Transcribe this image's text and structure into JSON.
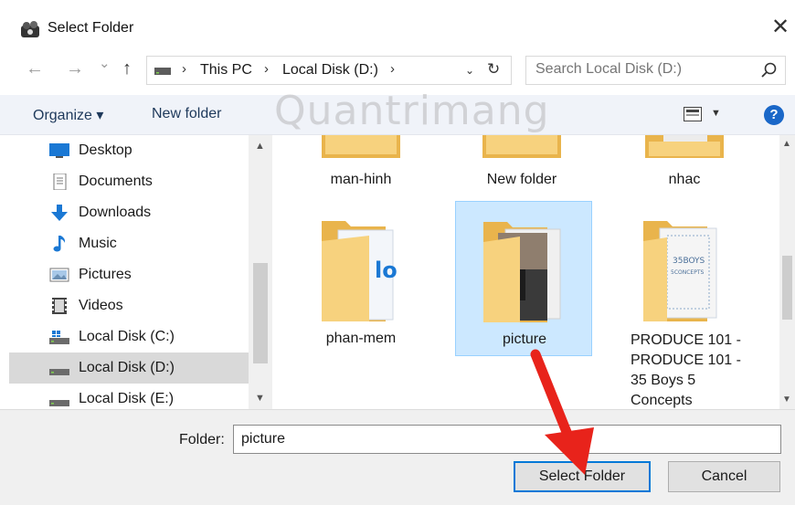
{
  "window": {
    "title": "Select Folder",
    "close_glyph": "✕"
  },
  "nav": {
    "back": "←",
    "forward": "→",
    "recent": "⌄",
    "up": "↑",
    "breadcrumb": [
      "This PC",
      "Local Disk (D:)"
    ],
    "sep": "›",
    "dropdown": "⌄",
    "refresh": "↻"
  },
  "search": {
    "placeholder": "Search Local Disk (D:)"
  },
  "toolbar": {
    "organize_label": "Organize ▾",
    "new_folder_label": "New folder",
    "help": "?"
  },
  "sidebar": {
    "items": [
      {
        "label": "Desktop",
        "icon": "desktop-icon"
      },
      {
        "label": "Documents",
        "icon": "documents-icon"
      },
      {
        "label": "Downloads",
        "icon": "downloads-icon"
      },
      {
        "label": "Music",
        "icon": "music-icon"
      },
      {
        "label": "Pictures",
        "icon": "pictures-icon"
      },
      {
        "label": "Videos",
        "icon": "videos-icon"
      },
      {
        "label": "Local Disk (C:)",
        "icon": "drive-c-icon"
      },
      {
        "label": "Local Disk (D:)",
        "icon": "drive-icon",
        "selected": true
      },
      {
        "label": "Local Disk (E:)",
        "icon": "drive-icon"
      }
    ]
  },
  "folders": [
    {
      "label": "man-hinh"
    },
    {
      "label": "New folder"
    },
    {
      "label": "nhac"
    },
    {
      "label": "phan-mem"
    },
    {
      "label": "picture",
      "selected": true
    },
    {
      "label_lines": [
        "PRODUCE 101 -",
        "PRODUCE 101 -",
        "35 Boys 5",
        "Concepts"
      ]
    }
  ],
  "thumbnails": {
    "phan_mem_text": "lo",
    "produce_text": [
      "35BOYS",
      "5CONCEPTS"
    ]
  },
  "watermark": "Quantrimang",
  "footer": {
    "folder_label": "Folder:",
    "folder_value": "picture",
    "select_label": "Select Folder",
    "cancel_label": "Cancel"
  },
  "colors": {
    "accent": "#0078d7",
    "selection": "#cce8ff",
    "toolbar": "#f0f3f9",
    "arrow": "#e8231b",
    "folder": "#f5c86b"
  }
}
